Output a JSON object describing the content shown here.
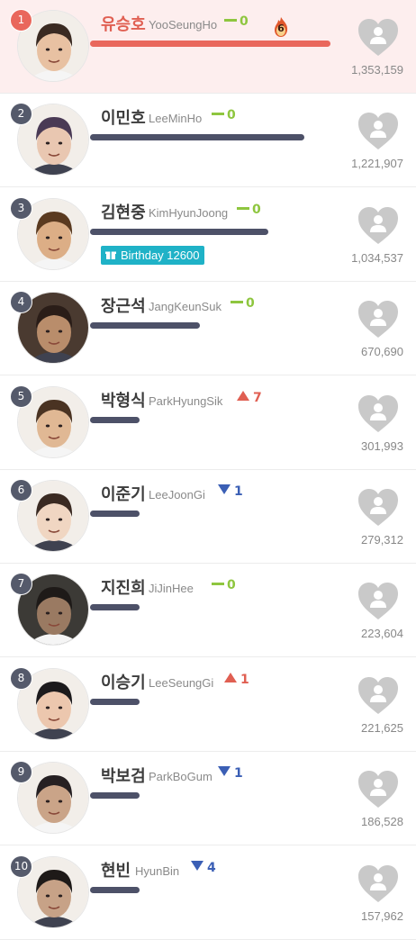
{
  "ranking": [
    {
      "rank": "1",
      "name_ko": "유승호",
      "name_en": "YooSeungHo",
      "change_dir": "same",
      "change_val": "0",
      "votes": "1,353,159",
      "vote_count": 1353159,
      "streak": "6",
      "skin": "#e8c1a2",
      "hair": "#3a2a22"
    },
    {
      "rank": "2",
      "name_ko": "이민호",
      "name_en": "LeeMinHo",
      "change_dir": "same",
      "change_val": "0",
      "votes": "1,221,907",
      "vote_count": 1221907,
      "skin": "#e9c7b1",
      "hair": "#4a3a55"
    },
    {
      "rank": "3",
      "name_ko": "김현중",
      "name_en": "KimHyunJoong",
      "change_dir": "same",
      "change_val": "0",
      "votes": "1,034,537",
      "vote_count": 1034537,
      "birthday": "Birthday 12600",
      "skin": "#dcae86",
      "hair": "#5a3a20"
    },
    {
      "rank": "4",
      "name_ko": "장근석",
      "name_en": "JangKeunSuk",
      "change_dir": "same",
      "change_val": "0",
      "votes": "670,690",
      "vote_count": 670690,
      "skin": "#b98d6b",
      "hair": "#2a1d18"
    },
    {
      "rank": "5",
      "name_ko": "박형식",
      "name_en": "ParkHyungSik",
      "change_dir": "up",
      "change_val": "7",
      "votes": "301,993",
      "vote_count": 301993,
      "skin": "#e0b894",
      "hair": "#4a3322"
    },
    {
      "rank": "6",
      "name_ko": "이준기",
      "name_en": "LeeJoonGi",
      "change_dir": "down",
      "change_val": "1",
      "votes": "279,312",
      "vote_count": 279312,
      "skin": "#f0d6c2",
      "hair": "#3a2a22"
    },
    {
      "rank": "7",
      "name_ko": "지진희",
      "name_en": "JiJinHee",
      "change_dir": "same",
      "change_val": "0",
      "votes": "223,604",
      "vote_count": 223604,
      "skin": "#9a7a62",
      "hair": "#1e1a18"
    },
    {
      "rank": "8",
      "name_ko": "이승기",
      "name_en": "LeeSeungGi",
      "change_dir": "up",
      "change_val": "1",
      "votes": "221,625",
      "vote_count": 221625,
      "skin": "#ecc7ae",
      "hair": "#1c1a1c"
    },
    {
      "rank": "9",
      "name_ko": "박보검",
      "name_en": "ParkBoGum",
      "change_dir": "down",
      "change_val": "1",
      "votes": "186,528",
      "vote_count": 186528,
      "skin": "#caa488",
      "hair": "#262022"
    },
    {
      "rank": "10",
      "name_ko": "현빈",
      "name_en": "HyunBin",
      "change_dir": "down",
      "change_val": "4",
      "votes": "157,962",
      "vote_count": 157962,
      "skin": "#c7a287",
      "hair": "#1e1a18"
    }
  ],
  "colors": {
    "accent": "#e9675c",
    "bar": "#4d5168",
    "same": "#8ec63f",
    "down": "#3b5fb5",
    "birthday": "#1fb2c7",
    "heart": "#c9c9c9",
    "highlight_bg": "#fdeeee"
  },
  "icons": {
    "vote": "heart-person-icon",
    "streak": "fire-icon",
    "birthday": "gift-icon"
  }
}
